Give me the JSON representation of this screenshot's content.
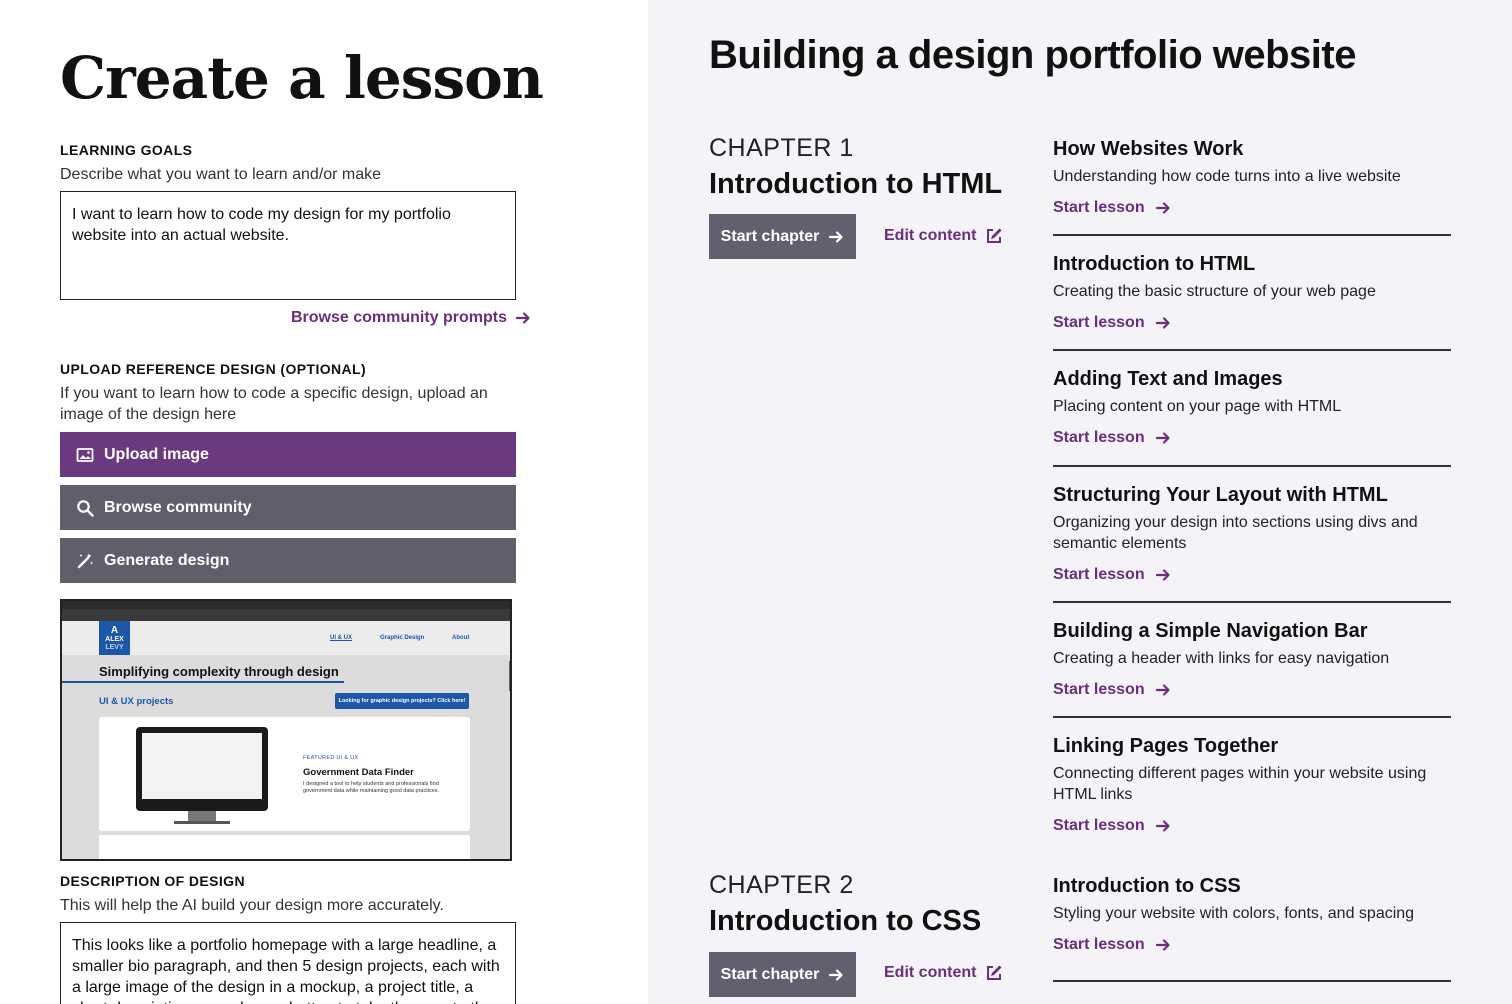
{
  "left": {
    "title": "Create a lesson",
    "goals": {
      "label": "LEARNING GOALS",
      "help": "Describe what you want to learn and/or make",
      "value": "I want to learn how to code my design for my portfolio website into an actual website."
    },
    "browse_prompts": "Browse community prompts",
    "upload": {
      "label": "UPLOAD REFERENCE DESIGN (OPTIONAL)",
      "help": "If you want to learn how to code a specific design, upload an image of the design here",
      "upload_btn": "Upload image",
      "browse_btn": "Browse community",
      "generate_btn": "Generate design"
    },
    "reference": {
      "logo_line1": "A",
      "logo_line2": "ALEX",
      "logo_line3": "LEVY",
      "nav": [
        "UI & UX",
        "Graphic Design",
        "About"
      ],
      "hero": "Simplifying complexity through design",
      "subhead": "UI & UX projects",
      "cta": "Looking for graphic design projects? Click here!",
      "featured": "FEATURED   UI & UX",
      "card_title": "Government Data Finder",
      "card_desc": "I designed a tool to help students and professionals find government data while maintaining good data practices."
    },
    "description": {
      "label": "DESCRIPTION OF DESIGN",
      "help": "This will help the AI build your design more accurately.",
      "value": "This looks like a portfolio homepage with a large headline, a smaller bio paragraph, and then 5 design projects, each with a large image of the design in a mockup, a project title, a short description, a read more button to take the user to the"
    }
  },
  "right": {
    "title": "Building a design portfolio website",
    "start_chapter": "Start chapter",
    "edit_content": "Edit content",
    "start_lesson": "Start lesson",
    "chapters": [
      {
        "number": "CHAPTER 1",
        "name": "Introduction to HTML"
      },
      {
        "number": "CHAPTER 2",
        "name": "Introduction to CSS"
      }
    ],
    "lessons": [
      {
        "title": "How Websites Work",
        "desc": "Understanding how code turns into a live website"
      },
      {
        "title": "Introduction to HTML",
        "desc": "Creating the basic structure of your web page"
      },
      {
        "title": "Adding Text and Images",
        "desc": "Placing content on your page with HTML"
      },
      {
        "title": "Structuring Your Layout with HTML",
        "desc": "Organizing your design into sections using divs and semantic elements"
      },
      {
        "title": "Building a Simple Navigation Bar",
        "desc": "Creating a header with links for easy navigation"
      },
      {
        "title": "Linking Pages Together",
        "desc": "Connecting different pages within your website using HTML links"
      },
      {
        "title": "Introduction to CSS",
        "desc": "Styling your website with colors, fonts, and spacing"
      }
    ]
  },
  "colors": {
    "accent_purple": "#6b3a7e",
    "link_purple": "#6b2e7c",
    "button_grey": "#615d6b",
    "right_bg": "#f4f4f8"
  }
}
